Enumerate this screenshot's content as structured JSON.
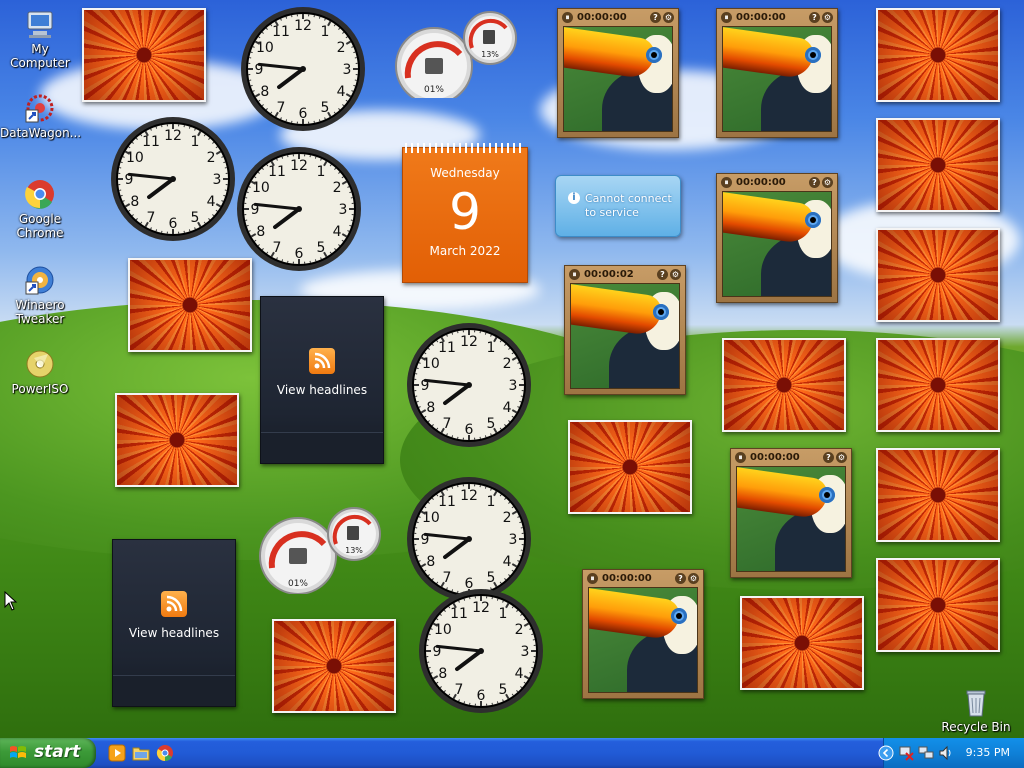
{
  "desktop": {
    "icons": [
      {
        "label": "My Computer",
        "icon": "computer-icon"
      },
      {
        "label": "DataWagon...",
        "icon": "datawagon-icon"
      },
      {
        "label": "Google Chrome",
        "icon": "chrome-icon"
      },
      {
        "label": "Winaero Tweaker",
        "icon": "winaero-tweaker-icon"
      },
      {
        "label": "PowerISO",
        "icon": "poweriso-icon"
      },
      {
        "label": "Recycle Bin",
        "icon": "recycle-bin-icon"
      }
    ]
  },
  "gadgets": {
    "calendar": {
      "weekday": "Wednesday",
      "day": "9",
      "month_year": "March 2022"
    },
    "meters": [
      {
        "cpu": "01%",
        "memory": "13%"
      },
      {
        "cpu": "01%",
        "memory": "13%"
      }
    ],
    "slideshows": [
      {
        "timer": "00:00:00"
      },
      {
        "timer": "00:00:00"
      },
      {
        "timer": "00:00:00"
      },
      {
        "timer": "00:00:02"
      },
      {
        "timer": "00:00:00"
      },
      {
        "timer": "00:00:00"
      }
    ],
    "feeds": [
      {
        "label": "View headlines",
        "icon": "rss-icon"
      },
      {
        "label": "View headlines",
        "icon": "rss-icon"
      }
    ],
    "weather": {
      "message": "Cannot connect to service",
      "icon": "info-icon"
    },
    "clock_time": "7:46"
  },
  "taskbar": {
    "start_label": "start",
    "quick_launch": [
      "media-player-icon",
      "explorer-icon",
      "chrome-icon"
    ],
    "tray_icons": [
      "chevron-left-icon",
      "network-disconnected-icon",
      "network-icon",
      "volume-icon"
    ],
    "clock": "9:35 PM"
  },
  "colors": {
    "taskbar": "#245edc",
    "start": "#3c9a38",
    "calendar": "#e86a0e"
  }
}
